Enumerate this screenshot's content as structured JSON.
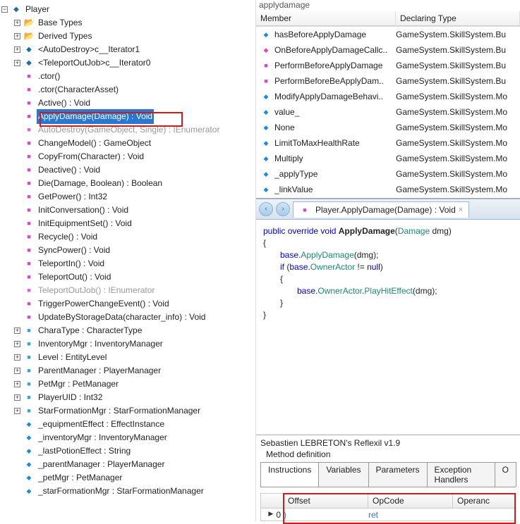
{
  "tree": {
    "root": "Player",
    "folders": {
      "base": "Base Types",
      "derived": "Derived Types"
    },
    "iter1": "<AutoDestroy>c__Iterator1",
    "iter2": "<TeleportOutJob>c__Iterator0",
    "m": {
      "ctor0": ".ctor()",
      "ctor1": ".ctor(CharacterAsset)",
      "active": "Active() : Void",
      "apply": "ApplyDamage(Damage) : Void",
      "autod": "AutoDestroy(GameObject, Single) : IEnumerator",
      "chmod": "ChangeModel() : GameObject",
      "copy": "CopyFrom(Character) : Void",
      "deact": "Deactive() : Void",
      "die": "Die(Damage, Boolean) : Boolean",
      "getp": "GetPower() : Int32",
      "initc": "InitConversation() : Void",
      "inite": "InitEquipmentSet() : Void",
      "rec": "Recycle() : Void",
      "syncp": "SyncPower() : Void",
      "tin": "TeleportIn() : Void",
      "tout": "TeleportOut() : Void",
      "toutj": "TeleportOutJob() : IEnumerator",
      "trig": "TriggerPowerChangeEvent() : Void",
      "upds": "UpdateByStorageData(character_info) : Void"
    },
    "p": {
      "ctype": "CharaType : CharacterType",
      "inv": "InventoryMgr : InventoryManager",
      "lvl": "Level : EntityLevel",
      "parent": "ParentManager : PlayerManager",
      "pet": "PetMgr : PetManager",
      "uid": "PlayerUID : Int32",
      "star": "StarFormationMgr : StarFormationManager"
    },
    "f": {
      "eqe": "_equipmentEffect : EffectInstance",
      "invm": "_inventoryMgr : InventoryManager",
      "lastp": "_lastPotionEffect : String",
      "pm": "_parentManager : PlayerManager",
      "petm": "_petMgr : PetManager",
      "sfm": "_starFormationMgr : StarFormationManager"
    }
  },
  "search": "applydamage",
  "table": {
    "h1": "Member",
    "h2": "Declaring Type",
    "rows": [
      {
        "n": "hasBeforeApplyDamage",
        "t": "GameSystem.SkillSystem.Bu"
      },
      {
        "n": "OnBeforeApplyDamageCallc..",
        "t": "GameSystem.SkillSystem.Bu"
      },
      {
        "n": "PerformBeforeApplyDamage",
        "t": "GameSystem.SkillSystem.Bu"
      },
      {
        "n": "PerformBeforeBeApplyDam..",
        "t": "GameSystem.SkillSystem.Bu"
      },
      {
        "n": "ModifyApplyDamageBehavi..",
        "t": "GameSystem.SkillSystem.Mo"
      },
      {
        "n": "value_",
        "t": "GameSystem.SkillSystem.Mo"
      },
      {
        "n": "None",
        "t": "GameSystem.SkillSystem.Mo"
      },
      {
        "n": "LimitToMaxHealthRate",
        "t": "GameSystem.SkillSystem.Mo"
      },
      {
        "n": "Multiply",
        "t": "GameSystem.SkillSystem.Mo"
      },
      {
        "n": "_applyType",
        "t": "GameSystem.SkillSystem.Mo"
      },
      {
        "n": "_linkValue",
        "t": "GameSystem.SkillSystem.Mo"
      }
    ]
  },
  "tab": "Player.ApplyDamage(Damage) : Void",
  "code": {
    "sig1_a": "public",
    "sig1_b": "override",
    "sig1_c": "void",
    "sig1_d": "ApplyDamage",
    "sig1_e": "Damage",
    "sig1_f": "dmg",
    "l2_a": "base",
    "l2_b": "ApplyDamage",
    "l2_c": "dmg",
    "l3_a": "if",
    "l3_b": "base",
    "l3_c": "OwnerActor",
    "l3_d": "null",
    "l4_a": "base",
    "l4_b": "OwnerActor",
    "l4_c": "PlayHitEffect",
    "l4_d": "dmg"
  },
  "reflexil": {
    "title": "Sebastien LEBRETON's Reflexil v1.9",
    "sub": "Method definition",
    "tabs": [
      "Instructions",
      "Variables",
      "Parameters",
      "Exception Handlers",
      "O"
    ],
    "cols": [
      "Offset",
      "OpCode",
      "Operanc"
    ],
    "row": {
      "idx": "0",
      "off": ")",
      "op": "ret",
      "opr": ""
    }
  }
}
